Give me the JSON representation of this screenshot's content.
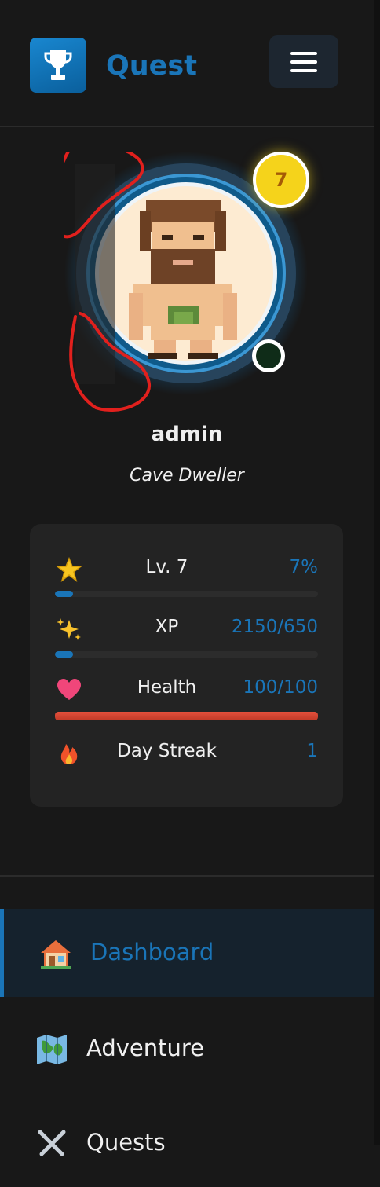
{
  "app": {
    "name": "Quest",
    "logo_icon": "trophy-icon",
    "menu_icon": "hamburger-icon"
  },
  "profile": {
    "username": "admin",
    "title": "Cave Dweller",
    "level_badge": "7",
    "avatar_icon": "pixel-caveman-avatar",
    "status": "online-indicator"
  },
  "stats": {
    "level": {
      "icon": "star-icon",
      "label": "Lv. 7",
      "value": "7%",
      "progress": 0.07
    },
    "xp": {
      "icon": "sparkles-icon",
      "label": "XP",
      "value": "2150/650",
      "progress": 0.07
    },
    "health": {
      "icon": "heart-icon",
      "label": "Health",
      "value": "100/100",
      "progress": 1.0
    },
    "streak": {
      "icon": "fire-icon",
      "label": "Day Streak",
      "value": "1"
    }
  },
  "nav": {
    "items": [
      {
        "label": "Dashboard",
        "icon": "house-icon",
        "active": true
      },
      {
        "label": "Adventure",
        "icon": "map-icon",
        "active": false
      },
      {
        "label": "Quests",
        "icon": "crossed-swords-icon",
        "active": false
      }
    ]
  },
  "colors": {
    "accent": "#1a75b8",
    "background": "#181818",
    "card": "#232323",
    "badge": "#f5d31b",
    "health": "#d9442f"
  }
}
